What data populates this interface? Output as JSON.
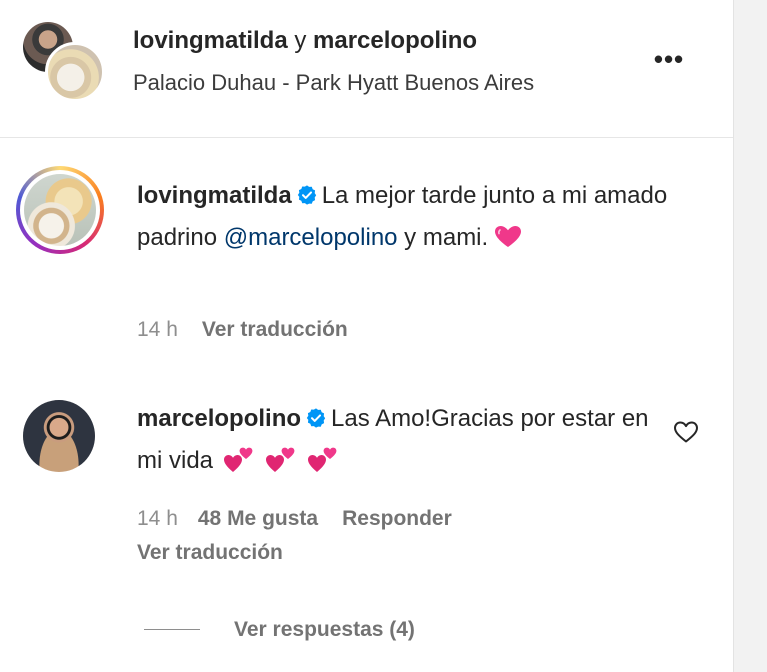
{
  "header": {
    "user_a": "lovingmatilda",
    "conjunction": " y ",
    "user_b": "marcelopolino",
    "location": "Palacio Duhau - Park Hyatt Buenos Aires",
    "more_label": "•••"
  },
  "comments": [
    {
      "username": "lovingmatilda",
      "verified": true,
      "text_before_mention": "La mejor tarde junto a mi amado padrino ",
      "mention": "@marcelopolino",
      "text_after_mention": " y mami.",
      "emoji": "pink-heart",
      "time": "14 h",
      "translate_label": "Ver traducción"
    },
    {
      "username": "marcelopolino",
      "verified": true,
      "text": "Las Amo!Gracias por estar en mi vida",
      "emojis": [
        "two-hearts",
        "two-hearts",
        "two-hearts"
      ],
      "time": "14 h",
      "likes_label": "48 Me gusta",
      "reply_label": "Responder",
      "translate_label": "Ver traducción",
      "view_replies_label": "Ver respuestas (4)"
    }
  ],
  "colors": {
    "text": "#262626",
    "secondary": "#737373",
    "mention": "#00376b",
    "verified": "#0095f6",
    "heart": "#f0388a"
  },
  "icons": {
    "more": "more-options-icon",
    "verified": "verified-badge-icon",
    "like": "heart-outline-icon"
  }
}
